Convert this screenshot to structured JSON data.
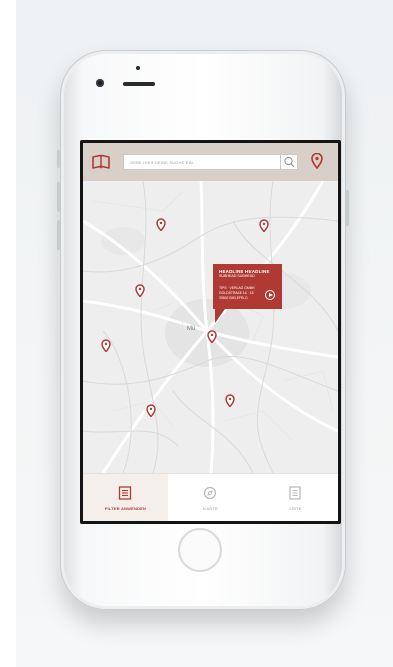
{
  "colors": {
    "accent": "#b03a33",
    "topbar_bg": "#d8d0c8",
    "map_bg": "#eeeeee"
  },
  "search": {
    "placeholder": "GEBE HIER DEINE SUCHE EIN...",
    "icon": "search-icon"
  },
  "header": {
    "left_icon": "book-icon",
    "right_icon": "map-pin-icon"
  },
  "map": {
    "city_label": "Mü",
    "pins": [
      {
        "name": "map-pin-1"
      },
      {
        "name": "map-pin-2"
      },
      {
        "name": "map-pin-3"
      },
      {
        "name": "map-pin-4"
      },
      {
        "name": "map-pin-5"
      },
      {
        "name": "map-pin-6"
      },
      {
        "name": "map-pin-7"
      },
      {
        "name": "map-pin-selected"
      }
    ]
  },
  "callout": {
    "headline": "HEADLINE HEADLINE",
    "subhead": "SUBHEAD SUBHEAD",
    "line1": "TIPS · VERLAG GMBH",
    "line2": "GOLDSTRAßE 16 · 18",
    "line3": "33602 BIELEFELD",
    "icon": "arrow-right-circle-icon"
  },
  "tabs": [
    {
      "label": "FILTER ANWENDEN",
      "icon": "filter-list-icon",
      "active": true
    },
    {
      "label": "KARTE",
      "icon": "compass-icon",
      "active": false
    },
    {
      "label": "LISTE",
      "icon": "list-icon",
      "active": false
    }
  ]
}
